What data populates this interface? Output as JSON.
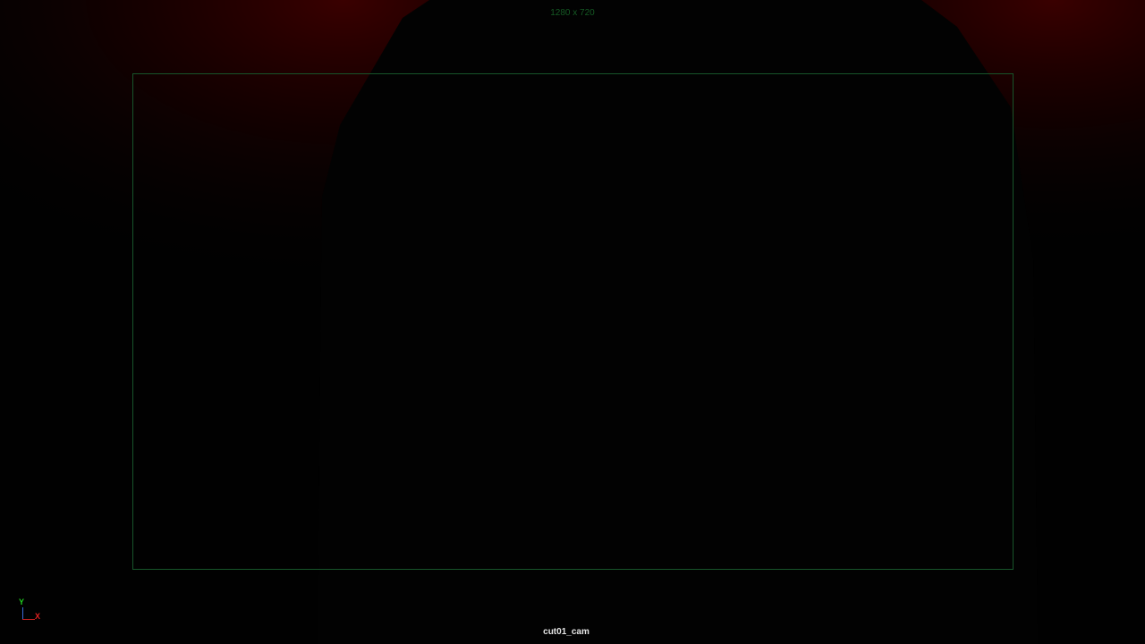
{
  "viewport": {
    "resolution_label": "1280 x 720",
    "camera_name": "cut01_cam",
    "axis": {
      "y_label": "Y",
      "x_label": "X"
    }
  },
  "colors": {
    "background": "#010101",
    "red_glow": "#3a0000",
    "resolution_gate": "#17552a",
    "axis_y": "#20d020",
    "axis_x": "#e02020"
  }
}
